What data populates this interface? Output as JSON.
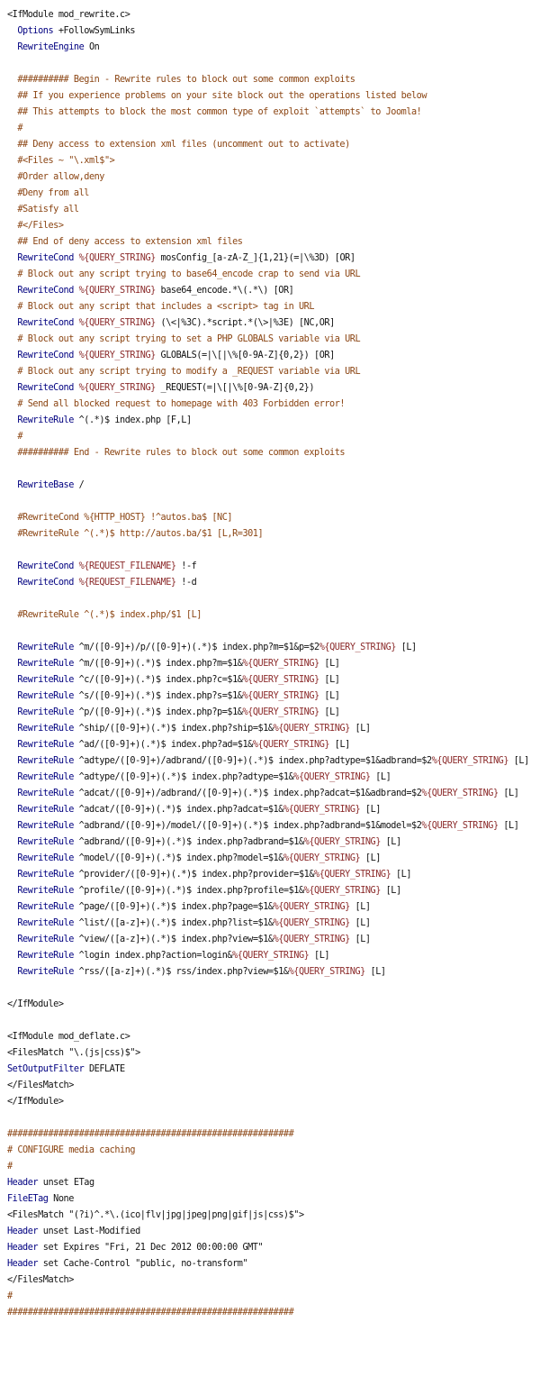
{
  "document": {
    "lines": [
      "<IfModule mod_rewrite.c>",
      "  Options +FollowSymLinks",
      "  RewriteEngine On",
      "",
      "  ########## Begin - Rewrite rules to block out some common exploits",
      "  ## If you experience problems on your site block out the operations listed below",
      "  ## This attempts to block the most common type of exploit `attempts` to Joomla!",
      "  #",
      "  ## Deny access to extension xml files (uncomment out to activate)",
      "  #<Files ~ \"\\.xml$\">",
      "  #Order allow,deny",
      "  #Deny from all",
      "  #Satisfy all",
      "  #</Files>",
      "  ## End of deny access to extension xml files",
      "  RewriteCond %{QUERY_STRING} mosConfig_[a-zA-Z_]{1,21}(=|\\%3D) [OR]",
      "  # Block out any script trying to base64_encode crap to send via URL",
      "  RewriteCond %{QUERY_STRING} base64_encode.*\\(.*\\) [OR]",
      "  # Block out any script that includes a <script> tag in URL",
      "  RewriteCond %{QUERY_STRING} (\\<|%3C).*script.*(\\>|%3E) [NC,OR]",
      "  # Block out any script trying to set a PHP GLOBALS variable via URL",
      "  RewriteCond %{QUERY_STRING} GLOBALS(=|\\[|\\%[0-9A-Z]{0,2}) [OR]",
      "  # Block out any script trying to modify a _REQUEST variable via URL",
      "  RewriteCond %{QUERY_STRING} _REQUEST(=|\\[|\\%[0-9A-Z]{0,2})",
      "  # Send all blocked request to homepage with 403 Forbidden error!",
      "  RewriteRule ^(.*)$ index.php [F,L]",
      "  #",
      "  ########## End - Rewrite rules to block out some common exploits",
      "",
      "  RewriteBase /",
      "",
      "  #RewriteCond %{HTTP_HOST} !^autos.ba$ [NC]",
      "  #RewriteRule ^(.*)$ http://autos.ba/$1 [L,R=301]",
      "",
      "  RewriteCond %{REQUEST_FILENAME} !-f",
      "  RewriteCond %{REQUEST_FILENAME} !-d",
      "",
      "  #RewriteRule ^(.*)$ index.php/$1 [L]",
      "",
      "  RewriteRule ^m/([0-9]+)/p/([0-9]+)(.*)$ index.php?m=$1&p=$2%{QUERY_STRING} [L]",
      "  RewriteRule ^m/([0-9]+)(.*)$ index.php?m=$1&%{QUERY_STRING} [L]",
      "  RewriteRule ^c/([0-9]+)(.*)$ index.php?c=$1&%{QUERY_STRING} [L]",
      "  RewriteRule ^s/([0-9]+)(.*)$ index.php?s=$1&%{QUERY_STRING} [L]",
      "  RewriteRule ^p/([0-9]+)(.*)$ index.php?p=$1&%{QUERY_STRING} [L]",
      "  RewriteRule ^ship/([0-9]+)(.*)$ index.php?ship=$1&%{QUERY_STRING} [L]",
      "  RewriteRule ^ad/([0-9]+)(.*)$ index.php?ad=$1&%{QUERY_STRING} [L]",
      "  RewriteRule ^adtype/([0-9]+)/adbrand/([0-9]+)(.*)$ index.php?adtype=$1&adbrand=$2%{QUERY_STRING} [L]",
      "  RewriteRule ^adtype/([0-9]+)(.*)$ index.php?adtype=$1&%{QUERY_STRING} [L]",
      "  RewriteRule ^adcat/([0-9]+)/adbrand/([0-9]+)(.*)$ index.php?adcat=$1&adbrand=$2%{QUERY_STRING} [L]",
      "  RewriteRule ^adcat/([0-9]+)(.*)$ index.php?adcat=$1&%{QUERY_STRING} [L]",
      "  RewriteRule ^adbrand/([0-9]+)/model/([0-9]+)(.*)$ index.php?adbrand=$1&model=$2%{QUERY_STRING} [L]",
      "  RewriteRule ^adbrand/([0-9]+)(.*)$ index.php?adbrand=$1&%{QUERY_STRING} [L]",
      "  RewriteRule ^model/([0-9]+)(.*)$ index.php?model=$1&%{QUERY_STRING} [L]",
      "  RewriteRule ^provider/([0-9]+)(.*)$ index.php?provider=$1&%{QUERY_STRING} [L]",
      "  RewriteRule ^profile/([0-9]+)(.*)$ index.php?profile=$1&%{QUERY_STRING} [L]",
      "  RewriteRule ^page/([0-9]+)(.*)$ index.php?page=$1&%{QUERY_STRING} [L]",
      "  RewriteRule ^list/([a-z]+)(.*)$ index.php?list=$1&%{QUERY_STRING} [L]",
      "  RewriteRule ^view/([a-z]+)(.*)$ index.php?view=$1&%{QUERY_STRING} [L]",
      "  RewriteRule ^login index.php?action=login&%{QUERY_STRING} [L]",
      "  RewriteRule ^rss/([a-z]+)(.*)$ rss/index.php?view=$1&%{QUERY_STRING} [L]",
      "",
      "</IfModule>",
      "",
      "<IfModule mod_deflate.c>",
      "<FilesMatch \"\\.(js|css)$\">",
      "SetOutputFilter DEFLATE",
      "</FilesMatch>",
      "</IfModule>",
      "",
      "########################################################",
      "# CONFIGURE media caching",
      "#",
      "Header unset ETag",
      "FileETag None",
      "<FilesMatch \"(?i)^.*\\.(ico|flv|jpg|jpeg|png|gif|js|css)$\">",
      "Header unset Last-Modified",
      "Header set Expires \"Fri, 21 Dec 2012 00:00:00 GMT\"",
      "Header set Cache-Control \"public, no-transform\"",
      "</FilesMatch>",
      "#",
      "########################################################"
    ]
  }
}
